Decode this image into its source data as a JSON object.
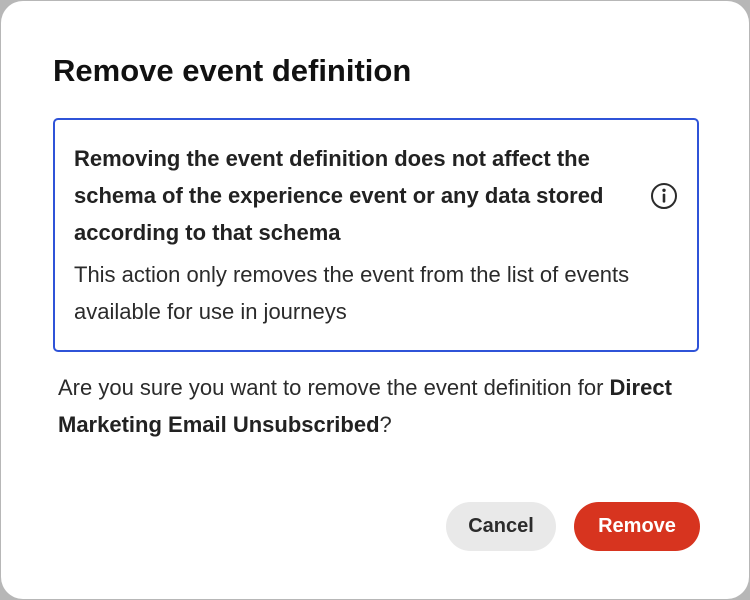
{
  "dialog": {
    "title": "Remove event definition",
    "notice": {
      "heading": "Removing the event definition does not affect the schema of the experience event or any data stored according to that schema",
      "body": "This action only removes the event from the list of events available for use in journeys",
      "icon": "info-icon",
      "border_color": "#2f53d8"
    },
    "confirmation": {
      "prefix": "Are you sure you want to remove the event definition for ",
      "event_name": "Direct Marketing Email Unsubscribed",
      "suffix": "?"
    },
    "buttons": {
      "cancel_label": "Cancel",
      "remove_label": "Remove"
    },
    "colors": {
      "remove_button": "#d7341f",
      "cancel_button": "#e9e9e9"
    }
  }
}
